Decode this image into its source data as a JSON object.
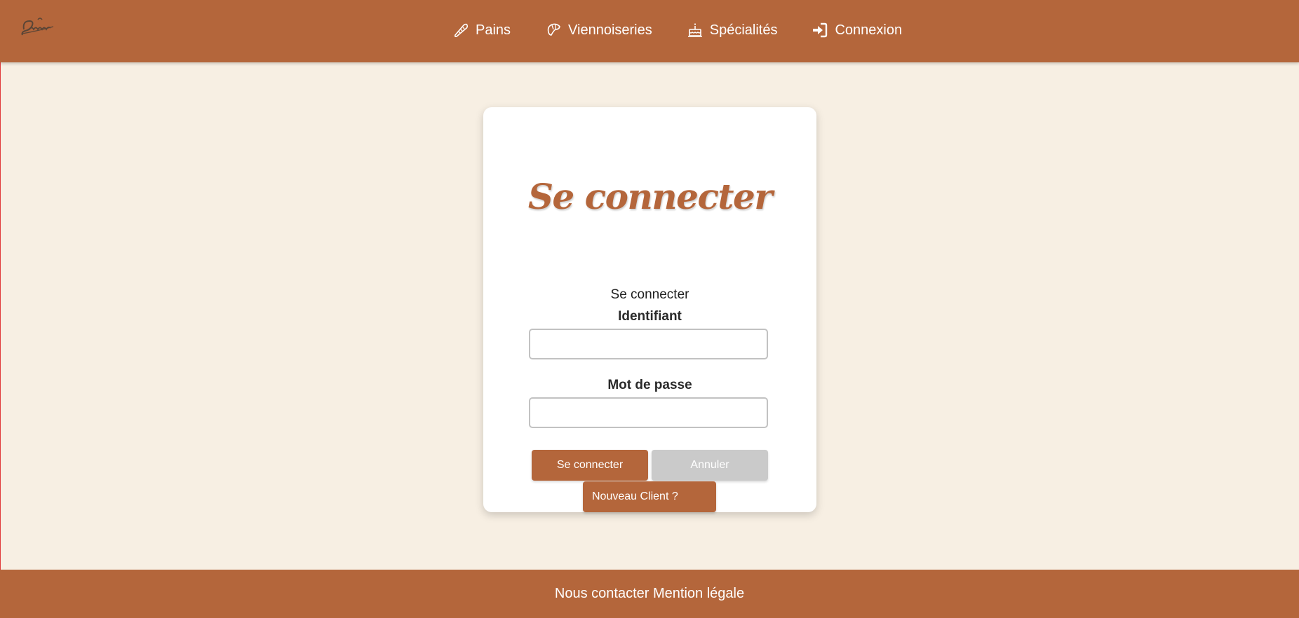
{
  "logo": {
    "alt": "Le Fournil"
  },
  "nav": {
    "items": [
      {
        "label": "Pains",
        "icon": "baguette-icon"
      },
      {
        "label": "Viennoiseries",
        "icon": "croissant-icon"
      },
      {
        "label": "Spécialités",
        "icon": "cake-icon"
      },
      {
        "label": "Connexion",
        "icon": "sign-in-icon"
      }
    ]
  },
  "login": {
    "title": "Se connecter",
    "subtitle": "Se connecter",
    "username_label": "Identifiant",
    "username_value": "",
    "password_label": "Mot de passe",
    "password_value": "",
    "submit_label": "Se connecter",
    "cancel_label": "Annuler",
    "new_client_label": "Nouveau Client ?"
  },
  "footer": {
    "contact_label": "Nous contacter",
    "legal_label": "Mention légale"
  },
  "colors": {
    "brand": "#b4663b",
    "background": "#f7efe3",
    "card": "#ffffff",
    "cancel": "#cacaca"
  }
}
